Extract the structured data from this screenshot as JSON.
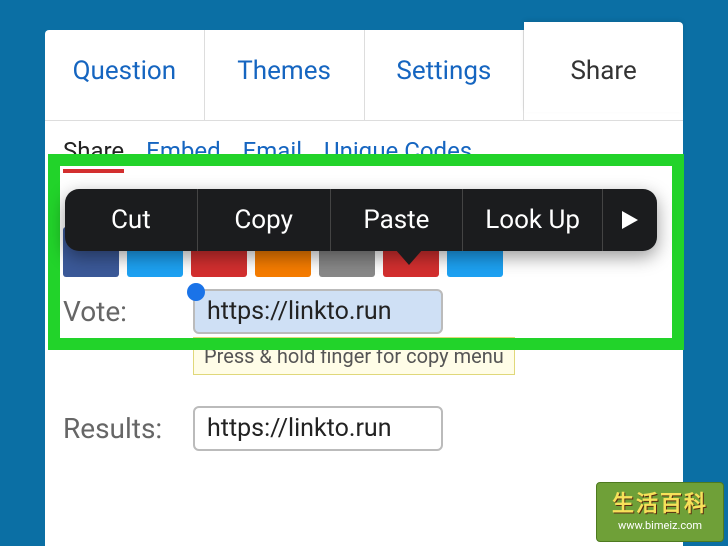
{
  "tabs": {
    "question": "Question",
    "themes": "Themes",
    "settings": "Settings",
    "share": "Share"
  },
  "subtabs": {
    "share": "Share",
    "embed": "Embed",
    "email": "Email",
    "unique_codes": "Unique Codes"
  },
  "fields": {
    "vote_label": "Vote:",
    "vote_url": "https://linkto.run",
    "results_label": "Results:",
    "results_url": "https://linkto.run",
    "tooltip": "Press & hold finger for copy menu"
  },
  "context_menu": {
    "items": [
      "Cut",
      "Copy",
      "Paste",
      "Look Up"
    ]
  },
  "watermark": {
    "title": "生活百科",
    "url": "www.bimeiz.com"
  }
}
